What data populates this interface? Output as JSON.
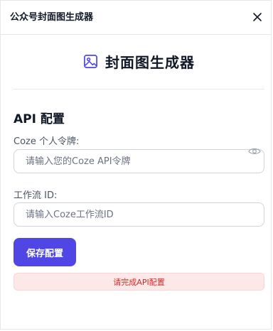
{
  "window": {
    "title": "公众号封面图生成器",
    "close_icon": "close-icon"
  },
  "hero": {
    "title": "封面图生成器",
    "icon": "image-icon",
    "icon_color": "#4f46e5"
  },
  "api_config": {
    "section_title": "API 配置",
    "token_label": "Coze 个人令牌:",
    "token_placeholder": "请输入您的Coze API令牌",
    "token_value": "",
    "workflow_label": "工作流 ID:",
    "workflow_placeholder": "请输入Coze工作流ID",
    "workflow_value": "",
    "save_label": "保存配置",
    "status_message": "请完成API配置"
  },
  "colors": {
    "accent": "#4f46e5",
    "error_text": "#dc2626",
    "error_bg": "#fde8e8"
  }
}
